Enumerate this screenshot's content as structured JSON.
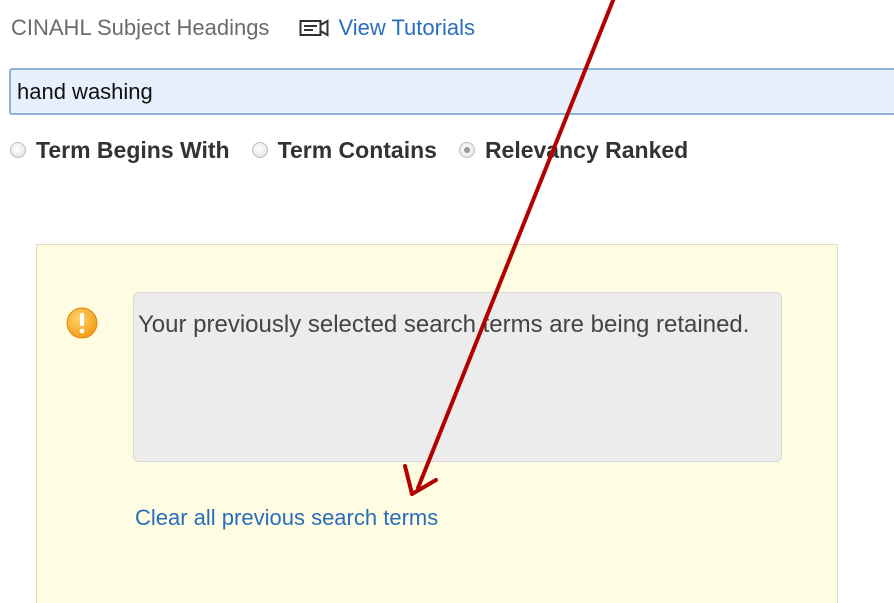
{
  "header": {
    "title": "CINAHL Subject Headings",
    "tutorials_label": "View Tutorials",
    "tutorials_icon": "video-icon"
  },
  "search": {
    "value": "hand washing"
  },
  "search_mode": {
    "options": [
      {
        "label": "Term Begins With",
        "checked": false
      },
      {
        "label": "Term Contains",
        "checked": false
      },
      {
        "label": "Relevancy Ranked",
        "checked": true
      }
    ]
  },
  "notice": {
    "icon": "warning-icon",
    "message": "Your previously selected search terms are being retained.",
    "clear_link": "Clear all previous search terms"
  },
  "annotation": {
    "icon": "arrow",
    "color": "#b30000"
  },
  "colors": {
    "link": "#2a6ebb",
    "warning_icon": "#f5a623",
    "notice_background": "#fefde3"
  }
}
